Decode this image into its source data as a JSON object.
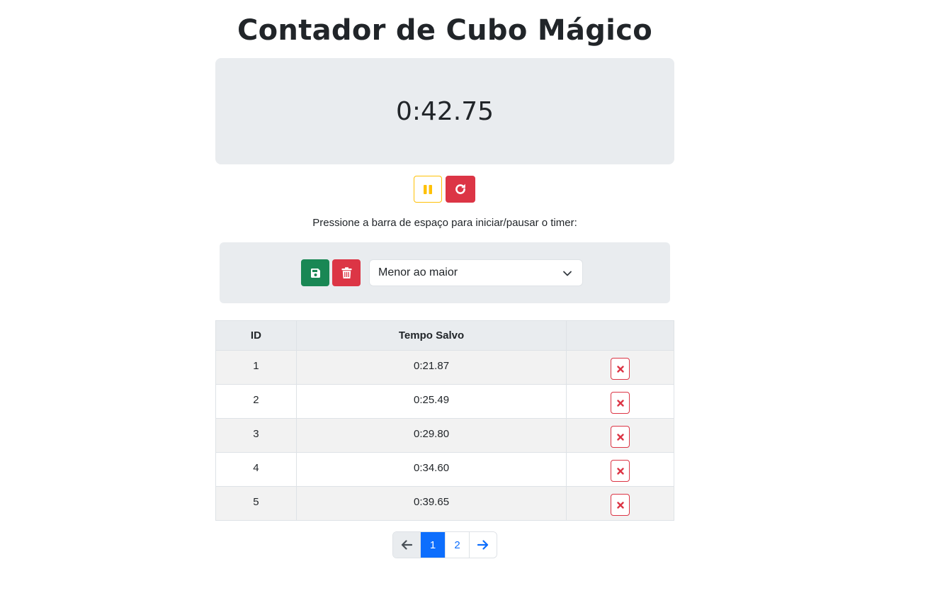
{
  "page": {
    "title": "Contador de Cubo Mágico"
  },
  "timer": {
    "display": "0:42.75"
  },
  "controls": {
    "pause_icon": "pause-icon",
    "reset_icon": "redo-icon"
  },
  "hint": "Pressione a barra de espaço para iniciar/pausar o timer:",
  "actions": {
    "save_icon": "floppy-disk-icon",
    "clear_icon": "trash-icon",
    "sort_select": {
      "selected": "Menor ao maior"
    }
  },
  "table": {
    "headers": [
      "ID",
      "Tempo Salvo",
      ""
    ],
    "rows": [
      {
        "id": "1",
        "time": "0:21.87"
      },
      {
        "id": "2",
        "time": "0:25.49"
      },
      {
        "id": "3",
        "time": "0:29.80"
      },
      {
        "id": "4",
        "time": "0:34.60"
      },
      {
        "id": "5",
        "time": "0:39.65"
      }
    ]
  },
  "pagination": {
    "pages": [
      "1",
      "2"
    ],
    "current": "1"
  },
  "colors": {
    "warning": "#ffc107",
    "danger": "#dc3545",
    "success": "#198754",
    "primary": "#0d6efd",
    "panel_bg": "#e9ecef"
  }
}
